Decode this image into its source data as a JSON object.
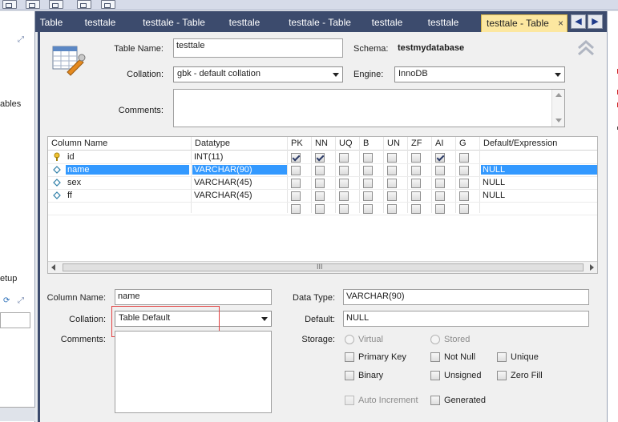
{
  "left_panel": {
    "line1": "ables",
    "line2": "etup"
  },
  "tabs": [
    {
      "label": "Table"
    },
    {
      "label": "testtale"
    },
    {
      "label": "testtale - Table"
    },
    {
      "label": "testtale"
    },
    {
      "label": "testtale - Table"
    },
    {
      "label": "testtale"
    },
    {
      "label": "testtale"
    },
    {
      "label": "testtale - Table",
      "active": true
    }
  ],
  "tab_close": "×",
  "tabnav": {
    "prev": "◀",
    "next": "▶"
  },
  "table_info": {
    "table_name_label": "Table Name:",
    "table_name_value": "testtale",
    "schema_label": "Schema:",
    "schema_value": "testmydatabase",
    "collation_label": "Collation:",
    "collation_value": "gbk - default collation",
    "engine_label": "Engine:",
    "engine_value": "InnoDB",
    "comments_label": "Comments:"
  },
  "grid": {
    "headers": [
      "Column Name",
      "Datatype",
      "PK",
      "NN",
      "UQ",
      "B",
      "UN",
      "ZF",
      "AI",
      "G",
      "Default/Expression"
    ],
    "rows": [
      {
        "name": "id",
        "datatype": "INT(11)",
        "flags": [
          true,
          true,
          false,
          false,
          false,
          false,
          true,
          false
        ],
        "default": "",
        "icon": "key"
      },
      {
        "name": "name",
        "datatype": "VARCHAR(90)",
        "flags": [
          false,
          false,
          false,
          false,
          false,
          false,
          false,
          false
        ],
        "default": "NULL",
        "icon": "diamond",
        "selected": true
      },
      {
        "name": "sex",
        "datatype": "VARCHAR(45)",
        "flags": [
          false,
          false,
          false,
          false,
          false,
          false,
          false,
          false
        ],
        "default": "NULL",
        "icon": "diamond"
      },
      {
        "name": "ff",
        "datatype": "VARCHAR(45)",
        "flags": [
          false,
          false,
          false,
          false,
          false,
          false,
          false,
          false
        ],
        "default": "NULL",
        "icon": "diamond"
      },
      {
        "name": "",
        "datatype": "",
        "flags": [
          false,
          false,
          false,
          false,
          false,
          false,
          false,
          false
        ],
        "default": "",
        "icon": ""
      }
    ],
    "scroll_grip": "III"
  },
  "column_details": {
    "column_name_label": "Column Name:",
    "column_name_value": "name",
    "collation_label": "Collation:",
    "collation_value": "Table Default",
    "comments_label": "Comments:",
    "data_type_label": "Data Type:",
    "data_type_value": "VARCHAR(90)",
    "default_label": "Default:",
    "default_value": "NULL",
    "storage_label": "Storage:",
    "virtual": "Virtual",
    "stored": "Stored",
    "primary_key": "Primary Key",
    "not_null": "Not Null",
    "unique": "Unique",
    "binary": "Binary",
    "unsigned": "Unsigned",
    "zero_fill": "Zero Fill",
    "auto_increment": "Auto Increment",
    "generated": "Generated"
  },
  "colors": {
    "tabbar": "#3c4b6d",
    "active_tab": "#fce7a0",
    "selection": "#3399ff",
    "highlight_box": "#e24040"
  }
}
